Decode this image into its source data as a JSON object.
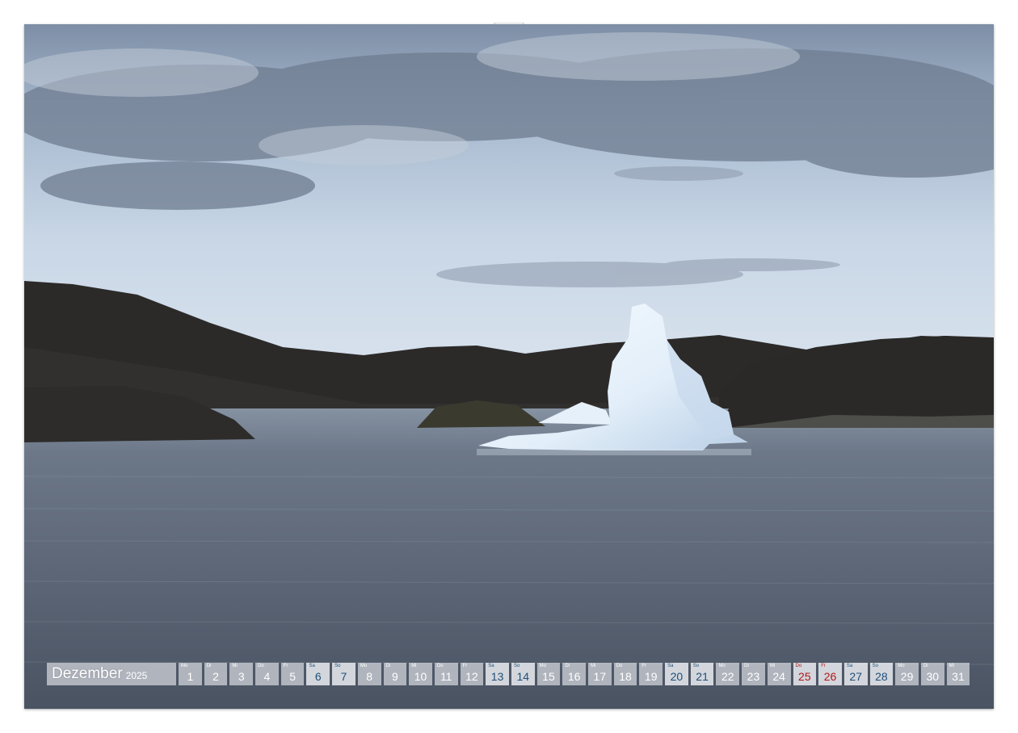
{
  "calendar": {
    "month": "Dezember",
    "year": "2025",
    "days": [
      {
        "num": "1",
        "wd": "Mo",
        "type": "weekday"
      },
      {
        "num": "2",
        "wd": "Di",
        "type": "weekday"
      },
      {
        "num": "3",
        "wd": "Mi",
        "type": "weekday"
      },
      {
        "num": "4",
        "wd": "Do",
        "type": "weekday"
      },
      {
        "num": "5",
        "wd": "Fr",
        "type": "weekday"
      },
      {
        "num": "6",
        "wd": "Sa",
        "type": "weekend"
      },
      {
        "num": "7",
        "wd": "So",
        "type": "weekend"
      },
      {
        "num": "8",
        "wd": "Mo",
        "type": "weekday"
      },
      {
        "num": "9",
        "wd": "Di",
        "type": "weekday"
      },
      {
        "num": "10",
        "wd": "Mi",
        "type": "weekday"
      },
      {
        "num": "11",
        "wd": "Do",
        "type": "weekday"
      },
      {
        "num": "12",
        "wd": "Fr",
        "type": "weekday"
      },
      {
        "num": "13",
        "wd": "Sa",
        "type": "weekend"
      },
      {
        "num": "14",
        "wd": "So",
        "type": "weekend"
      },
      {
        "num": "15",
        "wd": "Mo",
        "type": "weekday"
      },
      {
        "num": "16",
        "wd": "Di",
        "type": "weekday"
      },
      {
        "num": "17",
        "wd": "Mi",
        "type": "weekday"
      },
      {
        "num": "18",
        "wd": "Do",
        "type": "weekday"
      },
      {
        "num": "19",
        "wd": "Fr",
        "type": "weekday"
      },
      {
        "num": "20",
        "wd": "Sa",
        "type": "weekend"
      },
      {
        "num": "21",
        "wd": "So",
        "type": "weekend"
      },
      {
        "num": "22",
        "wd": "Mo",
        "type": "weekday"
      },
      {
        "num": "23",
        "wd": "Di",
        "type": "weekday"
      },
      {
        "num": "24",
        "wd": "Mi",
        "type": "weekday"
      },
      {
        "num": "25",
        "wd": "Do",
        "type": "holiday"
      },
      {
        "num": "26",
        "wd": "Fr",
        "type": "holiday"
      },
      {
        "num": "27",
        "wd": "Sa",
        "type": "weekend"
      },
      {
        "num": "28",
        "wd": "So",
        "type": "weekend"
      },
      {
        "num": "29",
        "wd": "Mo",
        "type": "weekday"
      },
      {
        "num": "30",
        "wd": "Di",
        "type": "weekday"
      },
      {
        "num": "31",
        "wd": "Mi",
        "type": "weekday"
      }
    ]
  },
  "colors": {
    "weekend": "#1f4f7a",
    "holiday": "#b01818",
    "sky": "#c9d6e4",
    "water": "#5a6676"
  }
}
